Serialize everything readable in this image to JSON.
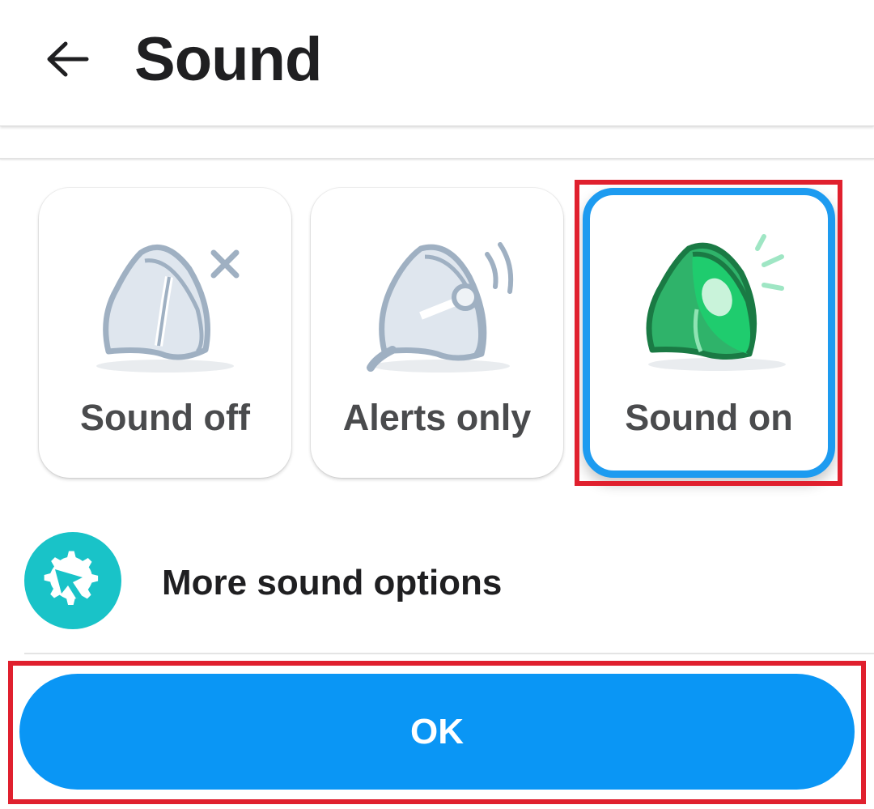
{
  "header": {
    "back_icon": "arrow-left-icon",
    "title": "Sound"
  },
  "sound_modes": [
    {
      "label": "Sound off",
      "icon": "speaker-muted-icon",
      "selected": false
    },
    {
      "label": "Alerts only",
      "icon": "speaker-alert-icon",
      "selected": false
    },
    {
      "label": "Sound on",
      "icon": "speaker-on-icon",
      "selected": true
    }
  ],
  "more_options": {
    "label": "More sound options",
    "icon": "gear-arrow-icon"
  },
  "ok_button": {
    "label": "OK"
  },
  "colors": {
    "accent_blue": "#0a96f5",
    "selected_border": "#1d9bf0",
    "highlight_red": "#e0202e",
    "speaker_green": "#1fc46a",
    "speaker_gray": "#9fb0c2",
    "teal": "#19c3c8"
  }
}
